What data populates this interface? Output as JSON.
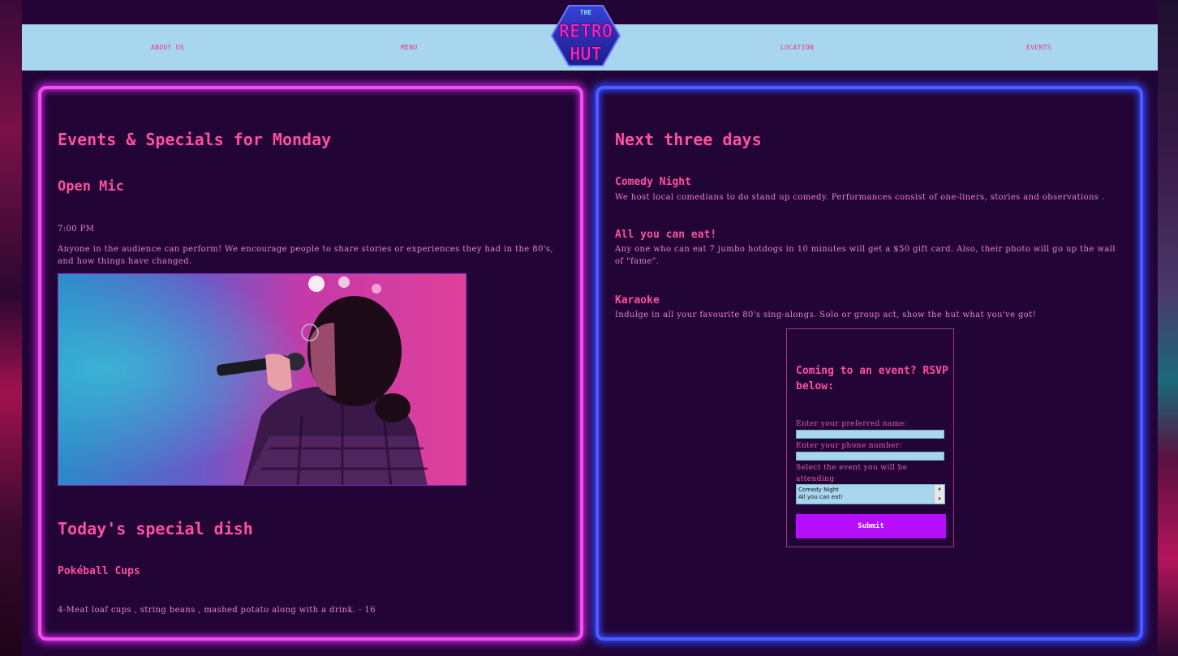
{
  "nav": {
    "about": "ABOUT US",
    "menu": "MENU",
    "location": "LOCATION",
    "events": "EVENTS"
  },
  "logo": {
    "line1": "THE",
    "line2": "RETRO",
    "line3": "HUT"
  },
  "left_panel": {
    "title": "Events & Specials for Monday",
    "event_name": "Open Mic",
    "event_time": "7:00 PM",
    "event_desc": "Anyone in the audience can perform! We encourage people to share stories or experiences they had in the 80's, and how things have changed.",
    "special_title": "Today's special dish",
    "dish_name": "Pokéball Cups",
    "dish_desc": "4-Meat loaf cups , string beans , mashed potato along with a drink. - 16"
  },
  "right_panel": {
    "title": "Next three days",
    "events": [
      {
        "name": "Comedy Night",
        "desc": "We host local comedians to do stand up comedy. Performances consist of one-liners, stories and observations ."
      },
      {
        "name": "All you can eat!",
        "desc": "Any one who can eat 7 jumbo hotdogs in 10 minutes will get a $50 gift card. Also, their photo will go up the wall of \"fame\"."
      },
      {
        "name": "Karaoke",
        "desc": "Indulge in all your favourite 80's sing-alongs. Solo or group act, show the hut what you've got!"
      }
    ],
    "rsvp": {
      "title": "Coming to an event? RSVP below:",
      "name_label": "Enter your preferred name:",
      "phone_label": "Enter your phone number:",
      "event_label": "Select the event you will be attending",
      "options": [
        "Comedy Night",
        "All you can eat!"
      ],
      "submit": "Submit"
    }
  },
  "colors": {
    "background": "#220536",
    "nav": "#a9d6ef",
    "accent_pink": "#ff4fa0",
    "neon_left": "#ee52ee",
    "neon_right": "#4a5cff",
    "submit": "#b60cff"
  }
}
